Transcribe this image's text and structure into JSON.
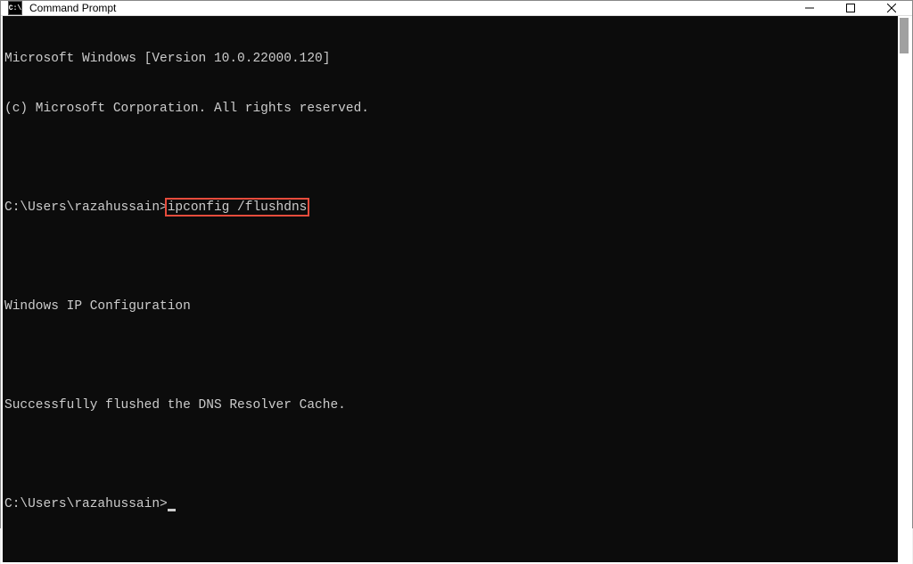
{
  "window": {
    "title": "Command Prompt",
    "icon_text": "C:\\"
  },
  "terminal": {
    "line1": "Microsoft Windows [Version 10.0.22000.120]",
    "line2": "(c) Microsoft Corporation. All rights reserved.",
    "prompt1_prefix": "C:\\Users\\razahussain>",
    "prompt1_command": "ipconfig /flushdns",
    "output_header": "Windows IP Configuration",
    "output_message": "Successfully flushed the DNS Resolver Cache.",
    "prompt2": "C:\\Users\\razahussain>"
  },
  "highlight": {
    "target_text": "ipconfig /flushdns"
  }
}
